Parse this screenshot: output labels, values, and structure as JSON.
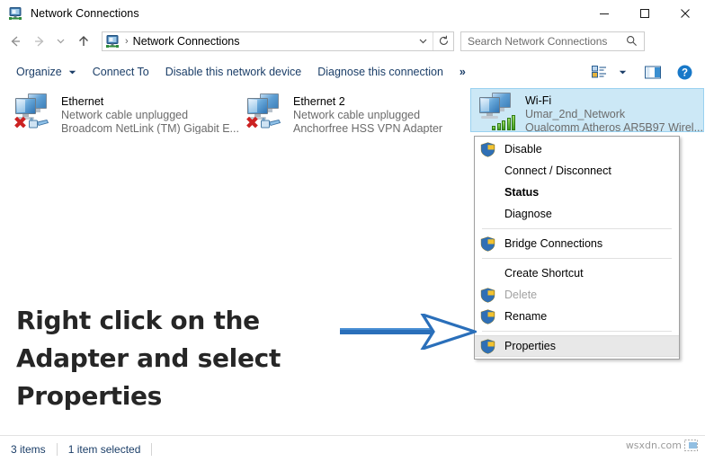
{
  "window": {
    "title": "Network Connections",
    "icon": "network-connections-icon",
    "buttons": {
      "minimize": "minimize-icon",
      "maximize": "maximize-icon",
      "close": "close-icon"
    }
  },
  "address_bar": {
    "back": "back-arrow-icon",
    "forward": "forward-arrow-icon",
    "recent": "recent-locations-icon",
    "up": "up-arrow-icon",
    "crumb_icon": "network-connections-icon",
    "separator": "›",
    "path": "Network Connections",
    "dropdown": "chevron-down-icon",
    "refresh": "refresh-icon"
  },
  "search": {
    "placeholder": "Search Network Connections",
    "icon": "search-icon"
  },
  "toolbar": {
    "items": [
      {
        "label": "Organize",
        "has_caret": true
      },
      {
        "label": "Connect To",
        "has_caret": false
      },
      {
        "label": "Disable this network device",
        "has_caret": false
      },
      {
        "label": "Diagnose this connection",
        "has_caret": false
      }
    ],
    "overflow": "»",
    "view_icon": "view-layout-icon",
    "view_caret": "chevron-down-icon",
    "preview_icon": "preview-pane-icon",
    "help_icon": "help-icon"
  },
  "adapters": [
    {
      "name": "Ethernet",
      "status": "Network cable unplugged",
      "device": "Broadcom NetLink (TM) Gigabit E...",
      "icon": "network-adapter-icon",
      "overlay": "red-x-unplugged-icon",
      "connector": "rj45-cable-icon",
      "selected": false
    },
    {
      "name": "Ethernet 2",
      "status": "Network cable unplugged",
      "device": "Anchorfree HSS VPN Adapter",
      "icon": "network-adapter-icon",
      "overlay": "red-x-unplugged-icon",
      "connector": "rj45-cable-icon",
      "selected": false
    },
    {
      "name": "Wi-Fi",
      "status": "Umar_2nd_Network",
      "device": "Qualcomm Atheros AR5B97 Wirel...",
      "icon": "network-adapter-icon",
      "overlay": "wifi-signal-bars-icon",
      "connector": "",
      "selected": true
    }
  ],
  "context_menu": [
    {
      "label": "Disable",
      "shield": true,
      "bold": false,
      "disabled": false,
      "highlight": false,
      "separator_after": false
    },
    {
      "label": "Connect / Disconnect",
      "shield": false,
      "bold": false,
      "disabled": false,
      "highlight": false,
      "separator_after": false
    },
    {
      "label": "Status",
      "shield": false,
      "bold": true,
      "disabled": false,
      "highlight": false,
      "separator_after": false
    },
    {
      "label": "Diagnose",
      "shield": false,
      "bold": false,
      "disabled": false,
      "highlight": false,
      "separator_after": true
    },
    {
      "label": "Bridge Connections",
      "shield": true,
      "bold": false,
      "disabled": false,
      "highlight": false,
      "separator_after": true
    },
    {
      "label": "Create Shortcut",
      "shield": false,
      "bold": false,
      "disabled": false,
      "highlight": false,
      "separator_after": false
    },
    {
      "label": "Delete",
      "shield": true,
      "bold": false,
      "disabled": true,
      "highlight": false,
      "separator_after": false
    },
    {
      "label": "Rename",
      "shield": true,
      "bold": false,
      "disabled": false,
      "highlight": false,
      "separator_after": true
    },
    {
      "label": "Properties",
      "shield": true,
      "bold": false,
      "disabled": false,
      "highlight": true,
      "separator_after": false
    }
  ],
  "annotation": {
    "text": "Right click on the Adapter and select Properties",
    "arrow": "right-arrow-annotation"
  },
  "status_bar": {
    "items_count": "3 items",
    "selection": "1 item selected"
  },
  "watermark": {
    "text": "wsxdn.com"
  },
  "colors": {
    "selection_fill": "#cce8f6",
    "selection_border": "#99d1f0",
    "menu_highlight": "#e8e8e8",
    "link_text": "#1b3e68",
    "arrow_blue": "#2a6fba",
    "annotation_text": "#262626"
  }
}
